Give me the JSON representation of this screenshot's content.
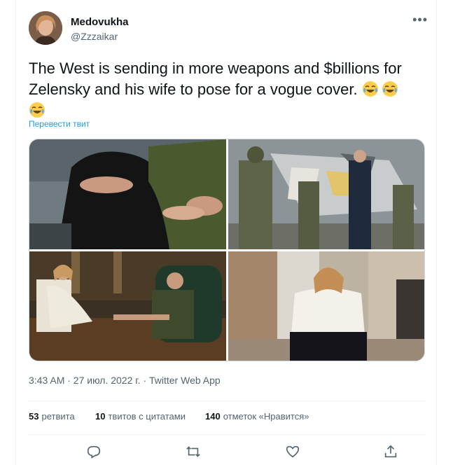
{
  "author": {
    "display_name": "Medovukha",
    "handle": "@Zzzaikar",
    "avatar_icon": "avatar-photo"
  },
  "tweet": {
    "text": "The West is sending in more weapons and $billions for Zelensky and his wife to pose for a vogue cover.",
    "emojis": [
      "face-with-tears-of-joy",
      "face-with-tears-of-joy",
      "face-with-tears-of-joy"
    ],
    "translate_label": "Перевести твит"
  },
  "media": {
    "photos": [
      {
        "name": "embrace-photo",
        "description_icon": "photo"
      },
      {
        "name": "soldiers-plane-photo",
        "description_icon": "photo"
      },
      {
        "name": "office-couple-photo",
        "description_icon": "photo"
      },
      {
        "name": "seated-woman-photo",
        "description_icon": "photo"
      }
    ]
  },
  "meta": {
    "timestamp": "3:43 AM · 27 июл. 2022 г. · Twitter Web App"
  },
  "stats": {
    "retweets_count": "53",
    "retweets_label": "ретвита",
    "quotes_count": "10",
    "quotes_label": "твитов с цитатами",
    "likes_count": "140",
    "likes_label": "отметок «Нравится»"
  },
  "actions": [
    "reply-icon",
    "retweet-icon",
    "like-icon",
    "share-icon"
  ],
  "colors": {
    "accent": "#1d9bf0",
    "secondary_text": "#536471",
    "primary_text": "#0f1419",
    "border": "#eff3f4"
  }
}
